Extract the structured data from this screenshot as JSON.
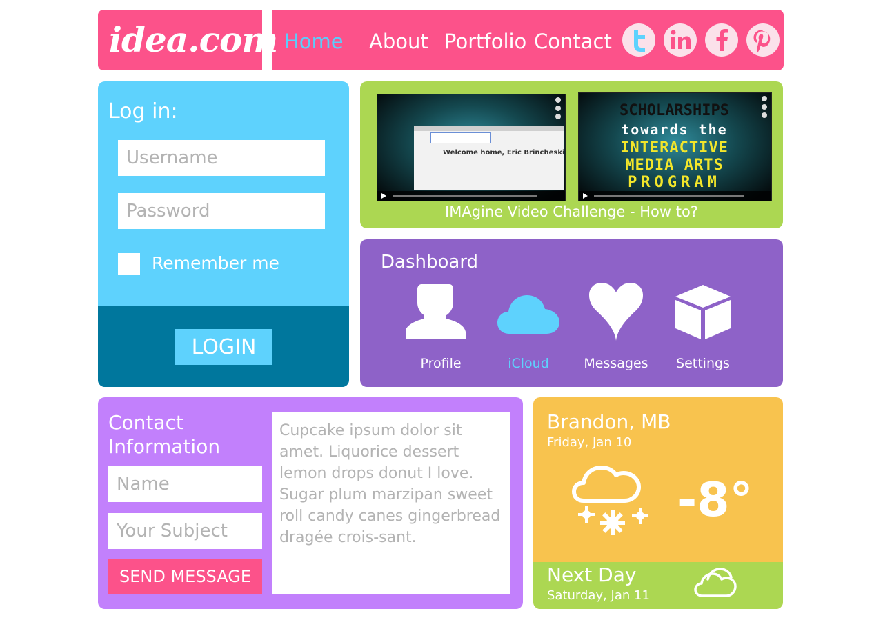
{
  "header": {
    "logo": "idea.com",
    "nav": [
      "Home",
      "About",
      "Portfolio",
      "Contact"
    ],
    "active_nav": "Home",
    "social": [
      "twitter-icon",
      "linkedin-icon",
      "facebook-icon",
      "pinterest-icon"
    ]
  },
  "login": {
    "title": "Log in:",
    "username_placeholder": "Username",
    "password_placeholder": "Password",
    "remember_label": "Remember me",
    "button": "LOGIN"
  },
  "videos": {
    "screen_text": "Welcome home, Eric Brincheski",
    "thumbnail_text": [
      "SCHOLARSHIPS",
      "towards the",
      "INTERACTIVE",
      "MEDIA ARTS",
      "PROGRAM"
    ],
    "caption": "IMAgine Video Challenge - How to?"
  },
  "dashboard": {
    "title": "Dashboard",
    "items": [
      {
        "label": "Profile",
        "icon": "profile-icon"
      },
      {
        "label": "iCloud",
        "icon": "cloud-icon",
        "active": true
      },
      {
        "label": "Messages",
        "icon": "heart-icon"
      },
      {
        "label": "Settings",
        "icon": "box-icon"
      }
    ]
  },
  "contact": {
    "title": "Contact Information",
    "name_placeholder": "Name",
    "subject_placeholder": "Your Subject",
    "send_button": "SEND MESSAGE",
    "message": "Cupcake ipsum dolor sit amet. Liquorice dessert lemon drops donut I love. Sugar plum marzipan sweet roll candy canes gingerbread dragée crois-sant."
  },
  "weather": {
    "city": "Brandon, MB",
    "date": "Friday, Jan 10",
    "temperature": "-8°",
    "icon": "snow-cloud-icon",
    "next_day_label": "Next Day",
    "next_date": "Saturday, Jan 11",
    "next_icon": "cloudy-icon"
  },
  "colors": {
    "pink": "#fc528a",
    "light_blue": "#5ed2fd",
    "dark_blue": "#00779d",
    "green": "#acd752",
    "purple": "#8e62c8",
    "lilac": "#c280fc",
    "yellow": "#f8c34e"
  }
}
